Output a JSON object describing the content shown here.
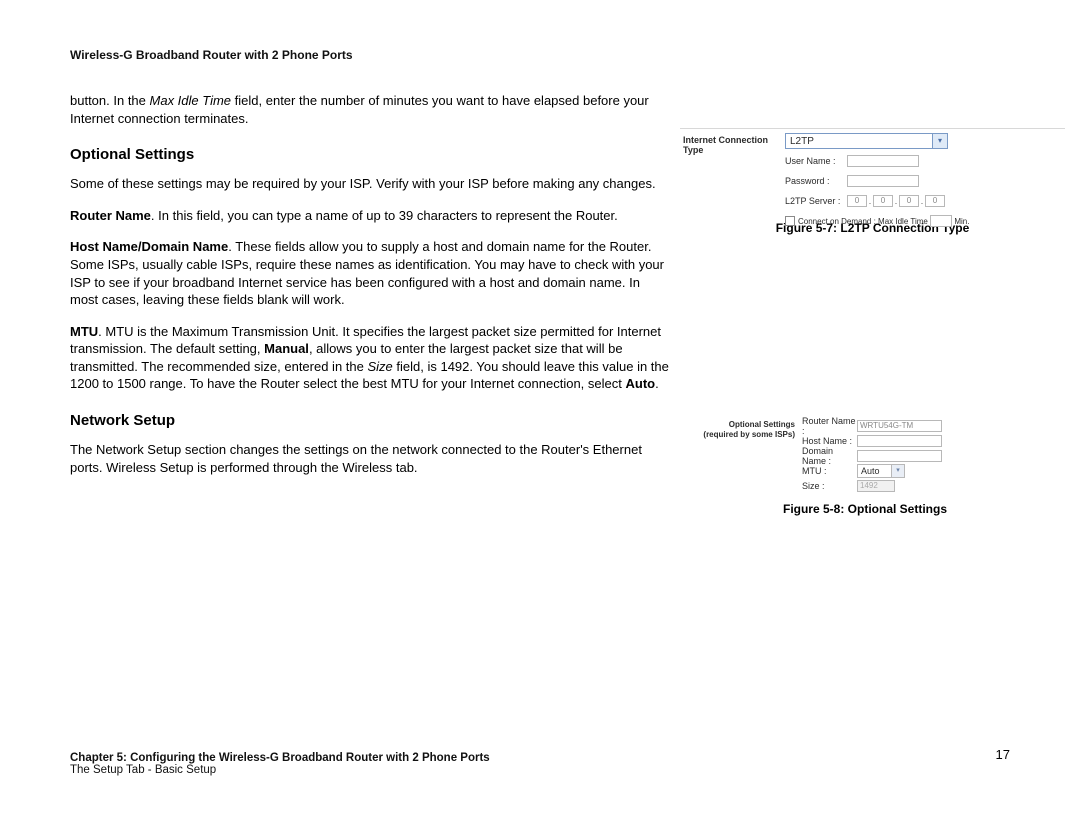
{
  "header": "Wireless-G Broadband Router with 2 Phone Ports",
  "intro": {
    "pre": "button. In the ",
    "ital": "Max Idle Time",
    "post": " field, enter the number of minutes you want to have elapsed before your Internet connection terminates."
  },
  "optional": {
    "heading": "Optional Settings",
    "p1": "Some of these settings may be required by your ISP. Verify with your ISP before making any changes.",
    "p2": {
      "b": "Router Name",
      "rest": ". In this field, you can type a name of up to 39 characters to represent the Router."
    },
    "p3": {
      "b": "Host Name/Domain Name",
      "rest": ". These fields allow you to supply a host and domain name for the Router. Some ISPs, usually cable ISPs, require these names as identification. You may have to check with your ISP to see if your broadband Internet service has been configured with a host and domain name. In most cases, leaving these fields blank will work."
    },
    "p4": {
      "b1": "MTU",
      "t1": ". MTU is the Maximum Transmission Unit. It specifies the largest packet size permitted for Internet transmission. The default setting, ",
      "b2": "Manual",
      "t2": ", allows you to enter the largest packet size that will be transmitted. The recommended size, entered in the ",
      "i": "Size",
      "t3": " field, is 1492. You should leave this value in the 1200 to 1500 range. To have the Router select the best MTU for your Internet connection, select ",
      "b3": "Auto",
      "t4": "."
    }
  },
  "network": {
    "heading": "Network Setup",
    "p": "The Network Setup section changes the settings on the network connected to the Router's Ethernet ports. Wireless Setup is performed through the Wireless tab."
  },
  "fig7": {
    "leftlabel": "Internet Connection Type",
    "select": "L2TP",
    "userlbl": "User Name  :",
    "passlbl": "Password  :",
    "srvlbl": "L2TP Server  :",
    "seg": [
      "0",
      "0",
      "0",
      "0"
    ],
    "cod": "Connect on Demand : Max Idle Time",
    "min": "Min.",
    "caption": "Figure 5-7: L2TP Connection Type"
  },
  "fig8": {
    "left1": "Optional Settings",
    "left2": "(required by some ISPs)",
    "rn_lbl": "Router Name  :",
    "rn_val": "WRTU54G-TM",
    "hn_lbl": "Host Name  :",
    "dn_lbl": "Domain Name  :",
    "mtu_lbl": "MTU  :",
    "mtu_val": "Auto",
    "size_lbl": "Size  :",
    "size_val": "1492",
    "caption": "Figure 5-8: Optional Settings"
  },
  "footer": {
    "l1a": "Chapter 5: Configuring the Wireless-G Broadband Router with 2 Phone Ports",
    "l2": "The Setup Tab - Basic Setup",
    "page": "17"
  }
}
